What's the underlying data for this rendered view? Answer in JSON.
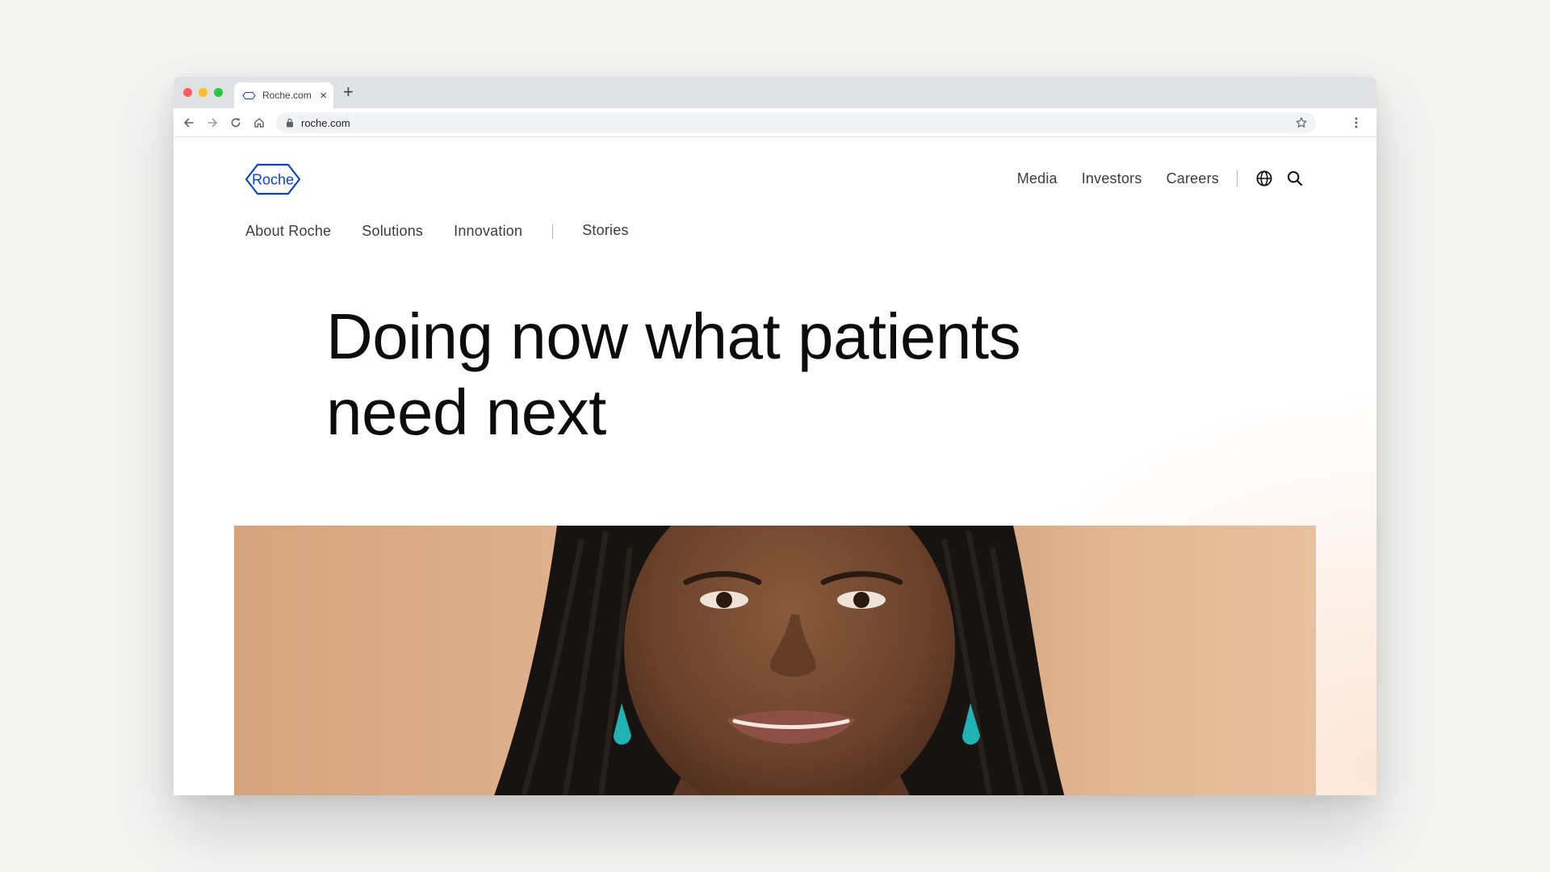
{
  "browser": {
    "tab_title": "Roche.com",
    "close_glyph": "×",
    "newtab_glyph": "+",
    "url": "roche.com"
  },
  "site": {
    "logo_text": "Roche",
    "top_nav": [
      "Media",
      "Investors",
      "Careers"
    ],
    "main_nav": [
      "About Roche",
      "Solutions",
      "Innovation",
      "Stories"
    ],
    "hero_title": "Doing now what patients need next"
  },
  "icons": {
    "back": "arrow-left-icon",
    "forward": "arrow-right-icon",
    "reload": "reload-icon",
    "home": "home-icon",
    "lock": "lock-icon",
    "bookmark": "star-icon",
    "menu": "kebab-menu-icon",
    "language": "globe-icon",
    "search": "search-icon"
  },
  "colors": {
    "brand_blue": "#0b41cd",
    "text": "#3d3d3d",
    "heading": "#0c0c0c"
  }
}
